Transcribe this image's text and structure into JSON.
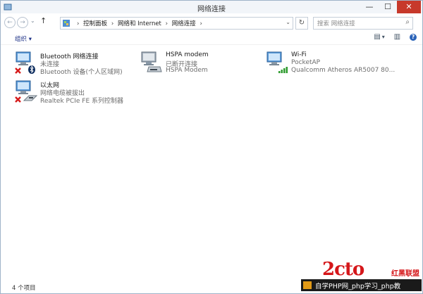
{
  "window": {
    "title": "网络连接",
    "close": "✕",
    "minimize": "—",
    "maximize": "☐"
  },
  "nav": {
    "back": "←",
    "forward": "→",
    "dropdown": "⌄",
    "up": "↑",
    "breadcrumb": [
      "控制面板",
      "网络和 Internet",
      "网络连接"
    ],
    "breadcrumb_sep": "›",
    "refresh": "↻",
    "search_placeholder": "搜索 网络连接"
  },
  "command": {
    "organize": "组织 ▾",
    "view_more": "▾"
  },
  "connections": [
    {
      "name": "Bluetooth 网络连接",
      "status": "未连接",
      "device": "Bluetooth 设备(个人区域网)"
    },
    {
      "name": "HSPA modem",
      "status": "已断开连接",
      "device": "HSPA Modem"
    },
    {
      "name": "Wi-Fi",
      "status": "PocketAP",
      "device": "Qualcomm Atheros AR5007 80..."
    },
    {
      "name": "以太网",
      "status": "网络电缆被拔出",
      "device": "Realtek PCIe FE 系列控制器"
    }
  ],
  "status": {
    "count": "4 个项目"
  },
  "watermark": {
    "logo": "2cto",
    "cn": "红黑联盟",
    "bar": "自学PHP网_php学习_php教"
  }
}
